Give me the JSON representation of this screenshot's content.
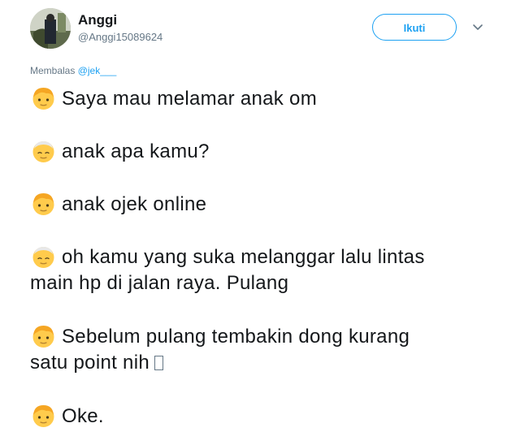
{
  "tweet": {
    "author_name": "Anggi",
    "author_handle": "@Anggi15089624",
    "follow_label": "Ikuti",
    "reply_prefix": "Membalas",
    "reply_to": "@jek___",
    "lines": [
      {
        "speaker": "young",
        "text": "Saya mau melamar anak om"
      },
      {
        "speaker": "old",
        "text": "anak apa kamu?"
      },
      {
        "speaker": "young",
        "text": "anak ojek online"
      },
      {
        "speaker": "old",
        "text": "oh kamu yang suka melanggar lalu lintas",
        "continuation": "main hp di jalan raya. Pulang"
      },
      {
        "speaker": "young",
        "text": "Sebelum pulang tembakin dong kurang",
        "continuation": "satu point nih"
      },
      {
        "speaker": "young",
        "text": "Oke."
      }
    ]
  },
  "icons": {
    "young": "blond-person-emoji-icon",
    "old": "older-person-emoji-icon",
    "caret": "chevron-down-icon",
    "missing": "missing-glyph-icon"
  },
  "colors": {
    "accent": "#1da1f2",
    "text": "#14171a",
    "secondary": "#657786",
    "emoji_skin": "#ffcb4c",
    "emoji_hair_young": "#f5a623",
    "emoji_hair_old": "#e8e8e8"
  }
}
